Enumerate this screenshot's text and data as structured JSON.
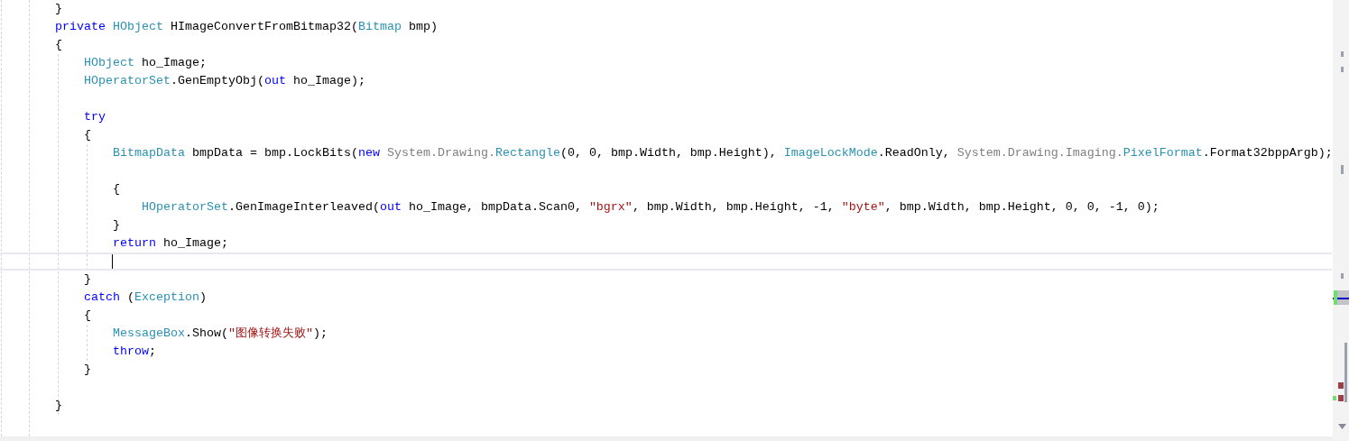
{
  "editor": {
    "lines": [
      {
        "current": false,
        "tokens": [
          {
            "text": "    }",
            "kind": "plain"
          }
        ]
      },
      {
        "current": false,
        "tokens": [
          {
            "text": "    private",
            "kind": "keyword"
          },
          {
            "text": " HObject",
            "kind": "type"
          },
          {
            "text": " HImageConvertFromBitmap32(",
            "kind": "plain"
          },
          {
            "text": "Bitmap",
            "kind": "type"
          },
          {
            "text": " bmp)",
            "kind": "plain"
          }
        ]
      },
      {
        "current": false,
        "tokens": [
          {
            "text": "    {",
            "kind": "plain"
          }
        ]
      },
      {
        "current": false,
        "tokens": [
          {
            "text": "        HObject",
            "kind": "type"
          },
          {
            "text": " ho_Image;",
            "kind": "plain"
          }
        ]
      },
      {
        "current": false,
        "tokens": [
          {
            "text": "        HOperatorSet",
            "kind": "type"
          },
          {
            "text": ".GenEmptyObj(",
            "kind": "plain"
          },
          {
            "text": "out",
            "kind": "keyword"
          },
          {
            "text": " ho_Image);",
            "kind": "plain"
          }
        ]
      },
      {
        "current": false
      },
      {
        "current": false,
        "tokens": [
          {
            "text": "        try",
            "kind": "keyword"
          }
        ]
      },
      {
        "current": false,
        "tokens": [
          {
            "text": "        {",
            "kind": "plain"
          }
        ]
      },
      {
        "current": false,
        "tokens": [
          {
            "text": "            BitmapData",
            "kind": "type"
          },
          {
            "text": " bmpData = bmp.LockBits(",
            "kind": "plain"
          },
          {
            "text": "new",
            "kind": "keyword"
          },
          {
            "text": " System.Drawing.",
            "kind": "qualifier"
          },
          {
            "text": "Rectangle",
            "kind": "type"
          },
          {
            "text": "(0, 0, bmp.Width, bmp.Height), ",
            "kind": "plain"
          },
          {
            "text": "ImageLockMode",
            "kind": "type"
          },
          {
            "text": ".ReadOnly, ",
            "kind": "plain"
          },
          {
            "text": "System.Drawing.Imaging.",
            "kind": "qualifier"
          },
          {
            "text": "PixelFormat",
            "kind": "type"
          },
          {
            "text": ".Format32bppArgb);",
            "kind": "plain"
          }
        ]
      },
      {
        "current": false
      },
      {
        "current": false,
        "tokens": [
          {
            "text": "            {",
            "kind": "plain"
          }
        ]
      },
      {
        "current": false,
        "tokens": [
          {
            "text": "                HOperatorSet",
            "kind": "type"
          },
          {
            "text": ".GenImageInterleaved(",
            "kind": "plain"
          },
          {
            "text": "out",
            "kind": "keyword"
          },
          {
            "text": " ho_Image, bmpData.Scan0, ",
            "kind": "plain"
          },
          {
            "text": "\"bgrx\"",
            "kind": "string"
          },
          {
            "text": ", bmp.Width, bmp.Height, -1, ",
            "kind": "plain"
          },
          {
            "text": "\"byte\"",
            "kind": "string"
          },
          {
            "text": ", bmp.Width, bmp.Height, 0, 0, -1, 0);",
            "kind": "plain"
          }
        ]
      },
      {
        "current": false,
        "tokens": [
          {
            "text": "            }",
            "kind": "plain"
          }
        ]
      },
      {
        "current": false,
        "tokens": [
          {
            "text": "            return",
            "kind": "keyword"
          },
          {
            "text": " ho_Image;",
            "kind": "plain"
          }
        ]
      },
      {
        "current": true
      },
      {
        "current": false,
        "tokens": [
          {
            "text": "        }",
            "kind": "plain"
          }
        ]
      },
      {
        "current": false,
        "tokens": [
          {
            "text": "        catch",
            "kind": "keyword"
          },
          {
            "text": " (",
            "kind": "plain"
          },
          {
            "text": "Exception",
            "kind": "type"
          },
          {
            "text": ")",
            "kind": "plain"
          }
        ]
      },
      {
        "current": false,
        "tokens": [
          {
            "text": "        {",
            "kind": "plain"
          }
        ]
      },
      {
        "current": false,
        "tokens": [
          {
            "text": "            MessageBox",
            "kind": "type"
          },
          {
            "text": ".Show(",
            "kind": "plain"
          },
          {
            "text": "\"图像转换失败\"",
            "kind": "string"
          },
          {
            "text": ");",
            "kind": "plain"
          }
        ]
      },
      {
        "current": false,
        "tokens": [
          {
            "text": "            throw",
            "kind": "keyword"
          },
          {
            "text": ";",
            "kind": "plain"
          }
        ]
      },
      {
        "current": false,
        "tokens": [
          {
            "text": "        }",
            "kind": "plain"
          }
        ]
      },
      {
        "current": false
      },
      {
        "current": false,
        "tokens": [
          {
            "text": "    }",
            "kind": "plain"
          }
        ]
      },
      {
        "current": false
      }
    ]
  }
}
